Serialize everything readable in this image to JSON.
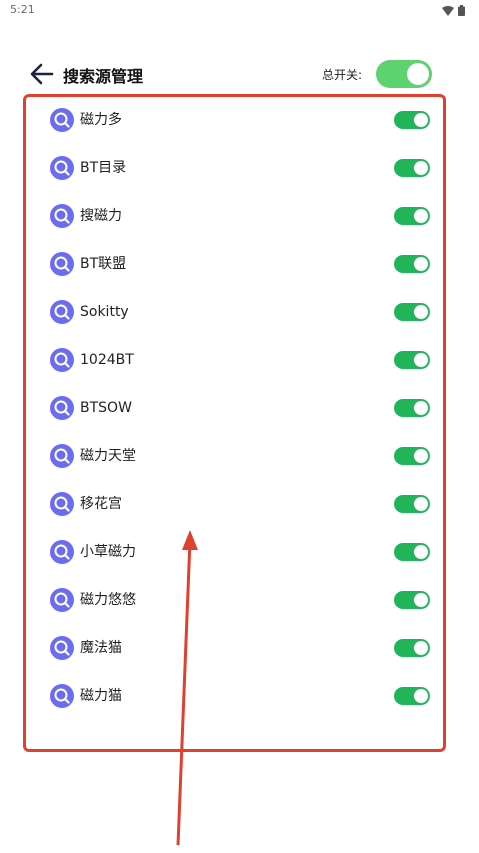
{
  "status_bar": {
    "time": "5:21",
    "icons": [
      "wifi-icon",
      "battery-icon"
    ]
  },
  "header": {
    "title": "搜索源管理",
    "master_switch_label": "总开关:",
    "master_switch_on": true
  },
  "sources": [
    {
      "label": "磁力多",
      "enabled": true
    },
    {
      "label": "BT目录",
      "enabled": true
    },
    {
      "label": "搜磁力",
      "enabled": true
    },
    {
      "label": "BT联盟",
      "enabled": true
    },
    {
      "label": "Sokitty",
      "enabled": true
    },
    {
      "label": "1024BT",
      "enabled": true
    },
    {
      "label": "BTSOW",
      "enabled": true
    },
    {
      "label": "磁力天堂",
      "enabled": true
    },
    {
      "label": "移花宫",
      "enabled": true
    },
    {
      "label": "小草磁力",
      "enabled": true
    },
    {
      "label": "磁力悠悠",
      "enabled": true
    },
    {
      "label": "魔法猫",
      "enabled": true
    },
    {
      "label": "磁力猫",
      "enabled": true
    }
  ],
  "colors": {
    "toggle_on": "#22b45a",
    "master_toggle_on": "#5ed26e",
    "source_icon": "#6c6cf0",
    "annotation": "#e0402e"
  }
}
